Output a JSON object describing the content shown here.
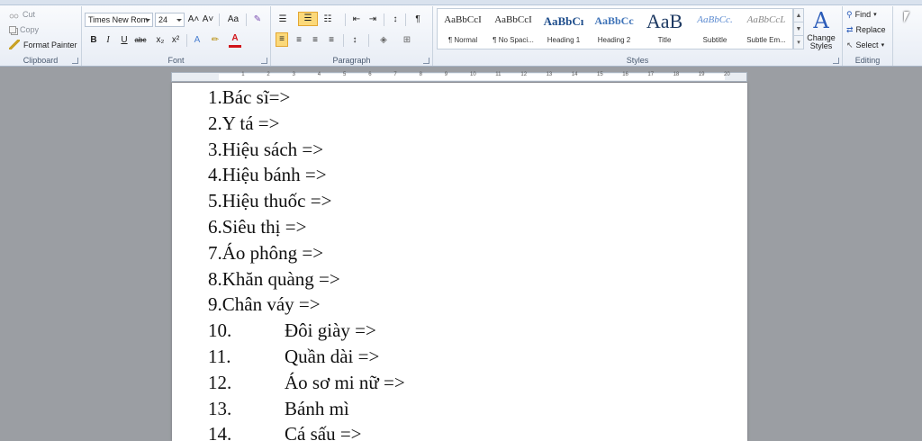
{
  "clipboard": {
    "cut": "Cut",
    "copy": "Copy",
    "format_painter": "Format Painter",
    "label": "Clipboard"
  },
  "font": {
    "family": "Times New Rom",
    "size": "24",
    "grow": "A˄",
    "shrink": "A˅",
    "change_case": "Aa",
    "bold": "B",
    "italic": "I",
    "underline": "U",
    "strike": "abc",
    "subscript": "x₂",
    "superscript": "x²",
    "font_color": "A",
    "label": "Font"
  },
  "paragraph": {
    "label": "Paragraph",
    "sort": "↕",
    "pilcrow": "¶"
  },
  "styles": {
    "label": "Styles",
    "items": [
      {
        "preview": "AaBbCcI",
        "name": "¶ Normal"
      },
      {
        "preview": "AaBbCcI",
        "name": "¶ No Spaci..."
      },
      {
        "preview": "AaBbCı",
        "name": "Heading 1"
      },
      {
        "preview": "AaBbCc",
        "name": "Heading 2"
      },
      {
        "preview": "AaB",
        "name": "Title"
      },
      {
        "preview": "AaBbCc.",
        "name": "Subtitle"
      },
      {
        "preview": "AaBbCcL",
        "name": "Subtle Em..."
      }
    ],
    "change_styles": "Change Styles"
  },
  "editing": {
    "label": "Editing",
    "find": "Find",
    "replace": "Replace",
    "select": "Select"
  },
  "ruler": {
    "numbers": [
      "1",
      "2",
      "3",
      "4",
      "5",
      "6",
      "7",
      "8",
      "9",
      "10",
      "11",
      "12",
      "13",
      "14",
      "15",
      "16",
      "17",
      "18",
      "19",
      "20"
    ]
  },
  "document": {
    "lines": [
      {
        "num": "1.",
        "text": "Bác sĩ=>"
      },
      {
        "num": "2.",
        "text": "Y tá =>"
      },
      {
        "num": "3.",
        "text": "Hiệu sách =>"
      },
      {
        "num": "4.",
        "text": "Hiệu bánh =>"
      },
      {
        "num": "5.",
        "text": "Hiệu thuốc =>"
      },
      {
        "num": "6.",
        "text": "Siêu thị =>"
      },
      {
        "num": "7.",
        "text": "Áo phông =>"
      },
      {
        "num": "8.",
        "text": "Khăn quàng =>"
      },
      {
        "num": "9.",
        "text": "Chân váy =>"
      },
      {
        "num": "10.",
        "text": "Đôi giày =>"
      },
      {
        "num": "11.",
        "text": "Quần dài =>"
      },
      {
        "num": "12.",
        "text": "Áo sơ mi nữ =>"
      },
      {
        "num": "13.",
        "text": "Bánh mì"
      },
      {
        "num": "14.",
        "text": "Cá sấu =>"
      }
    ]
  },
  "colors": {
    "ribbon_top": "#fbfcfe",
    "selected_button": "#fbd97a",
    "document_bg": "#9b9ea3"
  }
}
